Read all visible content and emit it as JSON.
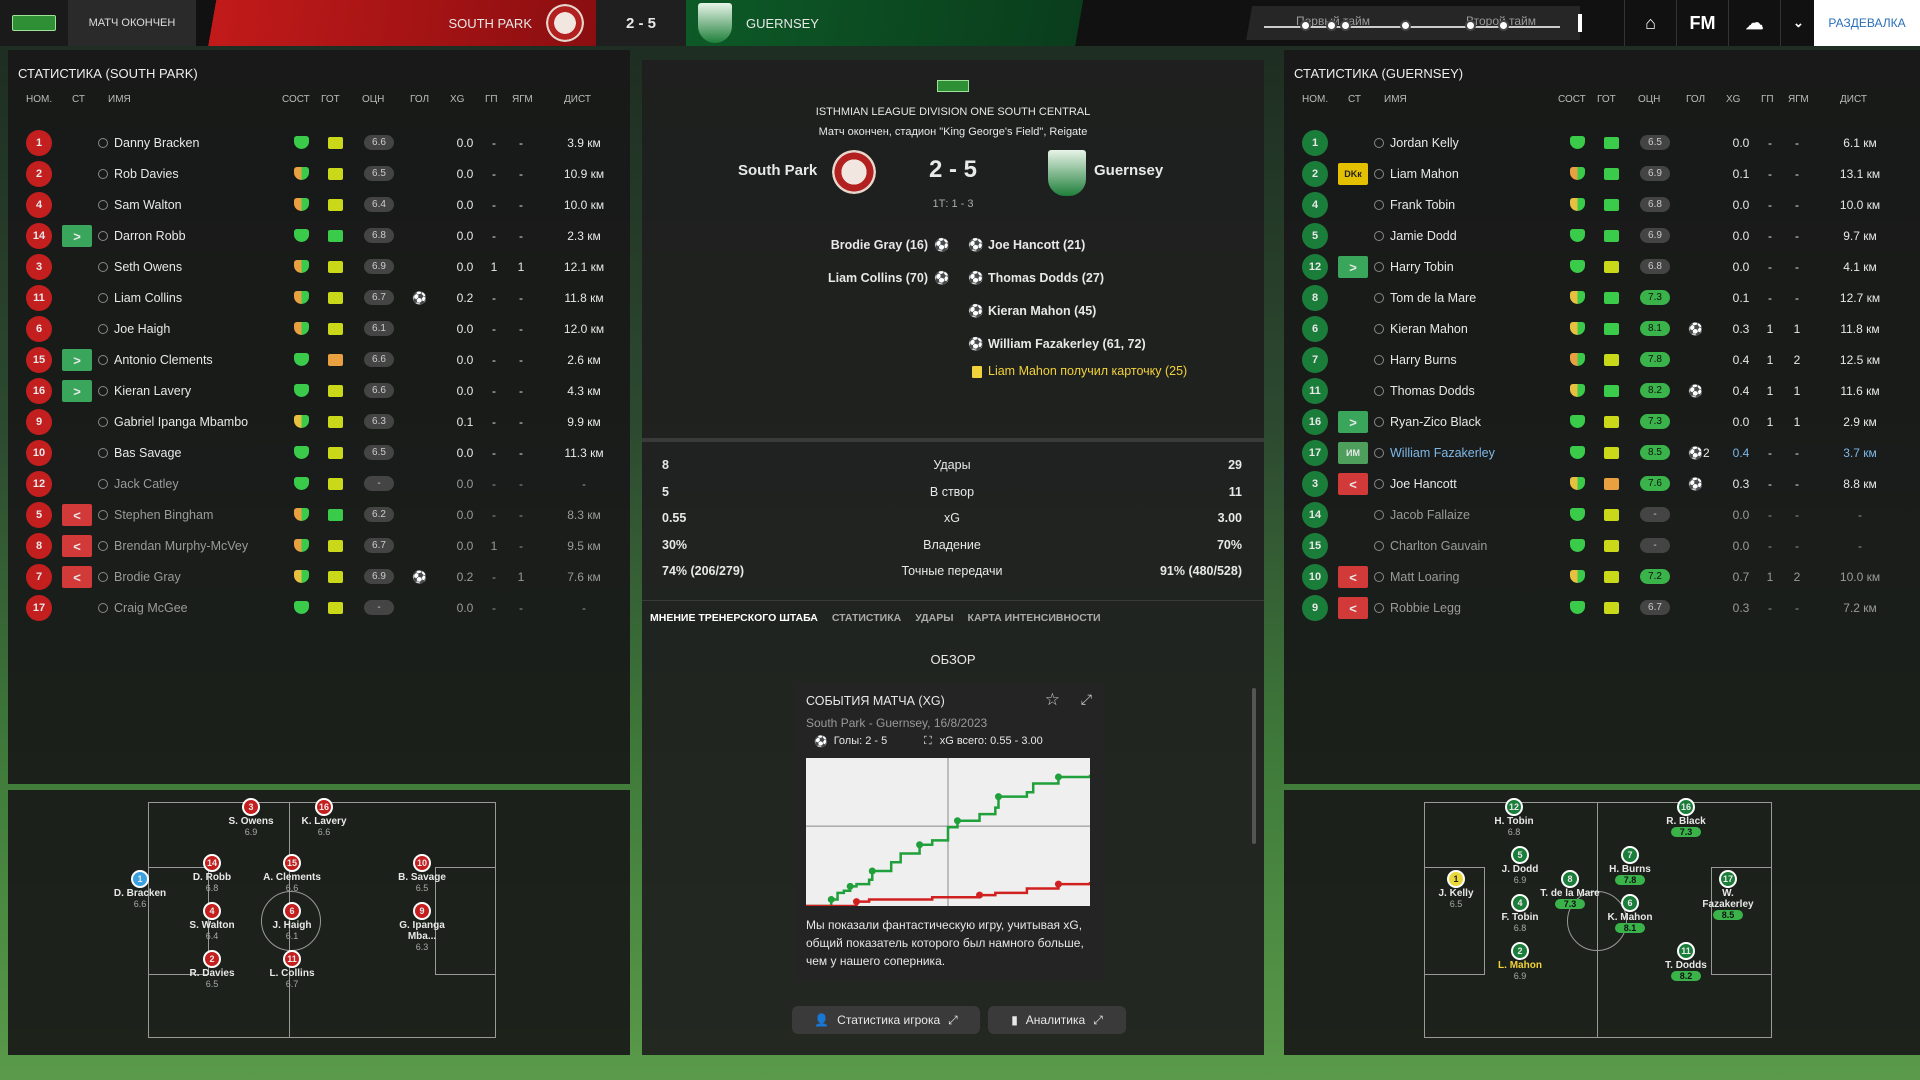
{
  "topbar": {
    "status": "МАТЧ ОКОНЧЕН",
    "home_team": "SOUTH PARK",
    "score": "2 - 5",
    "away_team": "GUERNSEY",
    "first_half": "Первый тайм",
    "second_half": "Второй тайм",
    "fm_label": "FM",
    "continue": "РАЗДЕВАЛКА"
  },
  "home": {
    "title": "СТАТИСТИКА (SOUTH PARK)",
    "headers": {
      "num": "НОМ.",
      "st": "СТ",
      "name": "ИМЯ",
      "cond": "СОСТ",
      "ready": "ГОТ",
      "rating": "ОЦН",
      "goals": "ГОЛ",
      "xg": "XG",
      "gp": "ГП",
      "ygm": "ЯГМ",
      "dist": "ДИСТ"
    },
    "players": [
      {
        "num": "1",
        "name": "Danny Bracken",
        "rating": "6.6",
        "goals": "",
        "xg": "0.0",
        "gp": "-",
        "ygm": "-",
        "dist": "3.9 км",
        "heart": "g",
        "fit": "y",
        "sub": ""
      },
      {
        "num": "2",
        "name": "Rob Davies",
        "rating": "6.5",
        "goals": "",
        "xg": "0.0",
        "gp": "-",
        "ygm": "-",
        "dist": "10.9 км",
        "heart": "o",
        "fit": "y",
        "sub": ""
      },
      {
        "num": "4",
        "name": "Sam Walton",
        "rating": "6.4",
        "goals": "",
        "xg": "0.0",
        "gp": "-",
        "ygm": "-",
        "dist": "10.0 км",
        "heart": "o",
        "fit": "y",
        "sub": ""
      },
      {
        "num": "14",
        "name": "Darron Robb",
        "rating": "6.8",
        "goals": "",
        "xg": "0.0",
        "gp": "-",
        "ygm": "-",
        "dist": "2.3 км",
        "heart": "g",
        "fit": "g",
        "sub": ">"
      },
      {
        "num": "3",
        "name": "Seth Owens",
        "rating": "6.9",
        "goals": "",
        "xg": "0.0",
        "gp": "1",
        "ygm": "1",
        "dist": "12.1 км",
        "heart": "o",
        "fit": "y",
        "sub": ""
      },
      {
        "num": "11",
        "name": "Liam Collins",
        "rating": "6.7",
        "goals": "⚽",
        "xg": "0.2",
        "gp": "-",
        "ygm": "-",
        "dist": "11.8 км",
        "heart": "o",
        "fit": "y",
        "sub": ""
      },
      {
        "num": "6",
        "name": "Joe Haigh",
        "rating": "6.1",
        "goals": "",
        "xg": "0.0",
        "gp": "-",
        "ygm": "-",
        "dist": "12.0 км",
        "heart": "o",
        "fit": "y",
        "sub": ""
      },
      {
        "num": "15",
        "name": "Antonio Clements",
        "rating": "6.6",
        "goals": "",
        "xg": "0.0",
        "gp": "-",
        "ygm": "-",
        "dist": "2.6 км",
        "heart": "g",
        "fit": "o",
        "sub": ">"
      },
      {
        "num": "16",
        "name": "Kieran Lavery",
        "rating": "6.6",
        "goals": "",
        "xg": "0.0",
        "gp": "-",
        "ygm": "-",
        "dist": "4.3 км",
        "heart": "g",
        "fit": "y",
        "sub": ">"
      },
      {
        "num": "9",
        "name": "Gabriel Ipanga Mbambo",
        "rating": "6.3",
        "goals": "",
        "xg": "0.1",
        "gp": "-",
        "ygm": "-",
        "dist": "9.9 км",
        "heart": "y",
        "fit": "y",
        "sub": ""
      },
      {
        "num": "10",
        "name": "Bas Savage",
        "rating": "6.5",
        "goals": "",
        "xg": "0.0",
        "gp": "-",
        "ygm": "-",
        "dist": "11.3 км",
        "heart": "g",
        "fit": "y",
        "sub": ""
      },
      {
        "num": "12",
        "name": "Jack Catley",
        "rating": "-",
        "goals": "",
        "xg": "0.0",
        "gp": "-",
        "ygm": "-",
        "dist": "-",
        "heart": "g",
        "fit": "y",
        "sub": "",
        "dim": true
      },
      {
        "num": "5",
        "name": "Stephen Bingham",
        "rating": "6.2",
        "goals": "",
        "xg": "0.0",
        "gp": "-",
        "ygm": "-",
        "dist": "8.3 км",
        "heart": "o",
        "fit": "g",
        "sub": "<",
        "dim": true
      },
      {
        "num": "8",
        "name": "Brendan Murphy-McVey",
        "rating": "6.7",
        "goals": "",
        "xg": "0.0",
        "gp": "1",
        "ygm": "-",
        "dist": "9.5 км",
        "heart": "o",
        "fit": "y",
        "sub": "<",
        "dim": true
      },
      {
        "num": "7",
        "name": "Brodie Gray",
        "rating": "6.9",
        "goals": "⚽",
        "xg": "0.2",
        "gp": "-",
        "ygm": "1",
        "dist": "7.6 км",
        "heart": "y",
        "fit": "y",
        "sub": "<",
        "dim": true
      },
      {
        "num": "17",
        "name": "Craig McGee",
        "rating": "-",
        "goals": "",
        "xg": "0.0",
        "gp": "-",
        "ygm": "-",
        "dist": "-",
        "heart": "g",
        "fit": "y",
        "sub": "",
        "dim": true
      }
    ],
    "pitch": [
      {
        "num": "3",
        "name": "S. Owens",
        "rt": "6.9"
      },
      {
        "num": "16",
        "name": "K. Lavery",
        "rt": "6.6"
      },
      {
        "num": "1",
        "name": "D. Bracken",
        "rt": "6.6"
      },
      {
        "num": "14",
        "name": "D. Robb",
        "rt": "6.8"
      },
      {
        "num": "15",
        "name": "A. Clements",
        "rt": "6.6"
      },
      {
        "num": "10",
        "name": "B. Savage",
        "rt": "6.5"
      },
      {
        "num": "4",
        "name": "S. Walton",
        "rt": "6.4"
      },
      {
        "num": "6",
        "name": "J. Haigh",
        "rt": "6.1"
      },
      {
        "num": "9",
        "name": "G. Ipanga Mba...",
        "rt": "6.3"
      },
      {
        "num": "2",
        "name": "R. Davies",
        "rt": "6.5"
      },
      {
        "num": "11",
        "name": "L. Collins",
        "rt": "6.7"
      }
    ]
  },
  "away": {
    "title": "СТАТИСТИКА (GUERNSEY)",
    "players": [
      {
        "num": "1",
        "name": "Jordan Kelly",
        "rating": "6.5",
        "goals": "",
        "xg": "0.0",
        "gp": "-",
        "ygm": "-",
        "dist": "6.1 км",
        "heart": "g",
        "fit": "g",
        "sub": ""
      },
      {
        "num": "2",
        "name": "Liam Mahon",
        "rating": "6.9",
        "goals": "",
        "xg": "0.1",
        "gp": "-",
        "ygm": "-",
        "dist": "13.1 км",
        "heart": "o",
        "fit": "g",
        "sub": "DKк"
      },
      {
        "num": "4",
        "name": "Frank Tobin",
        "rating": "6.8",
        "goals": "",
        "xg": "0.0",
        "gp": "-",
        "ygm": "-",
        "dist": "10.0 км",
        "heart": "y",
        "fit": "g",
        "sub": ""
      },
      {
        "num": "5",
        "name": "Jamie Dodd",
        "rating": "6.9",
        "goals": "",
        "xg": "0.0",
        "gp": "-",
        "ygm": "-",
        "dist": "9.7 км",
        "heart": "g",
        "fit": "g",
        "sub": ""
      },
      {
        "num": "12",
        "name": "Harry Tobin",
        "rating": "6.8",
        "goals": "",
        "xg": "0.0",
        "gp": "-",
        "ygm": "-",
        "dist": "4.1 км",
        "heart": "g",
        "fit": "y",
        "sub": ">"
      },
      {
        "num": "8",
        "name": "Tom de la Mare",
        "rating": "7.3",
        "goals": "",
        "xg": "0.1",
        "gp": "-",
        "ygm": "-",
        "dist": "12.7 км",
        "heart": "y",
        "fit": "g",
        "sub": "",
        "hi": true
      },
      {
        "num": "6",
        "name": "Kieran Mahon",
        "rating": "8.1",
        "goals": "⚽",
        "xg": "0.3",
        "gp": "1",
        "ygm": "1",
        "dist": "11.8 км",
        "heart": "y",
        "fit": "g",
        "sub": "",
        "hi": true
      },
      {
        "num": "7",
        "name": "Harry Burns",
        "rating": "7.8",
        "goals": "",
        "xg": "0.4",
        "gp": "1",
        "ygm": "2",
        "dist": "12.5 км",
        "heart": "o",
        "fit": "y",
        "sub": "",
        "hi": true
      },
      {
        "num": "11",
        "name": "Thomas Dodds",
        "rating": "8.2",
        "goals": "⚽",
        "xg": "0.4",
        "gp": "1",
        "ygm": "1",
        "dist": "11.6 км",
        "heart": "y",
        "fit": "g",
        "sub": "",
        "hi": true
      },
      {
        "num": "16",
        "name": "Ryan-Zico Black",
        "rating": "7.3",
        "goals": "",
        "xg": "0.0",
        "gp": "1",
        "ygm": "1",
        "dist": "2.9 км",
        "heart": "g",
        "fit": "y",
        "sub": ">",
        "hi": true
      },
      {
        "num": "17",
        "name": "William Fazakerley",
        "rating": "8.5",
        "goals": "⚽2",
        "xg": "0.4",
        "gp": "-",
        "ygm": "-",
        "dist": "3.7 км",
        "heart": "g",
        "fit": "y",
        "sub": "ИМ",
        "hi": true,
        "highlight": true
      },
      {
        "num": "3",
        "name": "Joe Hancott",
        "rating": "7.6",
        "goals": "⚽",
        "xg": "0.3",
        "gp": "-",
        "ygm": "-",
        "dist": "8.8 км",
        "heart": "y",
        "fit": "o",
        "sub": "<",
        "hi": true
      },
      {
        "num": "14",
        "name": "Jacob Fallaize",
        "rating": "-",
        "goals": "",
        "xg": "0.0",
        "gp": "-",
        "ygm": "-",
        "dist": "-",
        "heart": "g",
        "fit": "y",
        "sub": "",
        "dim": true
      },
      {
        "num": "15",
        "name": "Charlton Gauvain",
        "rating": "-",
        "goals": "",
        "xg": "0.0",
        "gp": "-",
        "ygm": "-",
        "dist": "-",
        "heart": "g",
        "fit": "y",
        "sub": "",
        "dim": true
      },
      {
        "num": "10",
        "name": "Matt Loaring",
        "rating": "7.2",
        "goals": "",
        "xg": "0.7",
        "gp": "1",
        "ygm": "2",
        "dist": "10.0 км",
        "heart": "y",
        "fit": "y",
        "sub": "<",
        "hi": true,
        "dim": true
      },
      {
        "num": "9",
        "name": "Robbie Legg",
        "rating": "6.7",
        "goals": "",
        "xg": "0.3",
        "gp": "-",
        "ygm": "-",
        "dist": "7.2 км",
        "heart": "g",
        "fit": "y",
        "sub": "<",
        "dim": true
      }
    ],
    "pitch": [
      {
        "num": "12",
        "name": "H. Tobin",
        "rt": "6.8"
      },
      {
        "num": "16",
        "name": "R. Black",
        "rt": "7.3",
        "hi": true
      },
      {
        "num": "1",
        "name": "J. Kelly",
        "rt": "6.5"
      },
      {
        "num": "5",
        "name": "J. Dodd",
        "rt": "6.9"
      },
      {
        "num": "8",
        "name": "T. de la Mare",
        "rt": "7.3",
        "hi": true
      },
      {
        "num": "7",
        "name": "H. Burns",
        "rt": "7.8",
        "hi": true
      },
      {
        "num": "17",
        "name": "W. Fazakerley",
        "rt": "8.5",
        "hi": true
      },
      {
        "num": "4",
        "name": "F. Tobin",
        "rt": "6.8"
      },
      {
        "num": "6",
        "name": "K. Mahon",
        "rt": "8.1",
        "hi": true
      },
      {
        "num": "2",
        "name": "L. Mahon",
        "rt": "6.9"
      },
      {
        "num": "11",
        "name": "T. Dodds",
        "rt": "8.2",
        "hi": true
      }
    ]
  },
  "match": {
    "league": "ISTHMIAN LEAGUE DIVISION ONE SOUTH CENTRAL",
    "venue": "Матч окончен, стадион \"King George's Field\", Reigate",
    "home": "South Park",
    "away": "Guernsey",
    "score": "2 - 5",
    "ht": "1Т: 1 - 3",
    "home_goals": [
      "Brodie Gray (16)",
      "Liam Collins (70)"
    ],
    "away_goals": [
      "Joe Hancott (21)",
      "Thomas Dodds (27)",
      "Kieran Mahon (45)",
      "William Fazakerley (61, 72)"
    ],
    "card": "Liam Mahon получил карточку (25)",
    "stats": [
      {
        "h": "8",
        "label": "Удары",
        "a": "29"
      },
      {
        "h": "5",
        "label": "В створ",
        "a": "11"
      },
      {
        "h": "0.55",
        "label": "xG",
        "a": "3.00"
      },
      {
        "h": "30%",
        "label": "Владение",
        "a": "70%"
      },
      {
        "h": "74% (206/279)",
        "label": "Точные передачи",
        "a": "91% (480/528)"
      }
    ],
    "tabs": [
      "МНЕНИЕ ТРЕНЕРСКОГО ШТАБА",
      "СТАТИСТИКА",
      "УДАРЫ",
      "КАРТА ИНТЕНСИВНОСТИ"
    ],
    "overview": "ОБЗОР",
    "card_title": "СОБЫТИЯ МАТЧА (XG)",
    "card_sub": "South Park - Guernsey, 16/8/2023",
    "card_goals": "Голы: 2 - 5",
    "card_xg": "xG всего: 0.55 - 3.00",
    "comment": "Мы показали фантастическую игру, учитывая xG, общий показатель которого был намного больше, чем у нашего соперника.",
    "btn_player": "Статистика игрока",
    "btn_analytics": "Аналитика"
  },
  "chart_data": {
    "type": "line",
    "series": [
      {
        "color": "#1fa03a",
        "x": [
          0,
          8,
          10,
          12,
          14,
          16,
          20,
          21,
          27,
          30,
          36,
          40,
          45,
          48,
          55,
          60,
          61,
          70,
          72,
          80,
          90
        ],
        "y": [
          0,
          0.15,
          0.3,
          0.35,
          0.45,
          0.5,
          0.6,
          0.8,
          1.0,
          1.2,
          1.4,
          1.5,
          1.8,
          1.95,
          2.1,
          2.25,
          2.5,
          2.6,
          2.8,
          2.95,
          3.0
        ]
      },
      {
        "color": "#d02020",
        "x": [
          0,
          16,
          20,
          40,
          55,
          60,
          70,
          80,
          90
        ],
        "y": [
          0,
          0.1,
          0.15,
          0.2,
          0.25,
          0.3,
          0.4,
          0.5,
          0.55
        ]
      }
    ],
    "xlim": [
      0,
      90
    ],
    "ylim": [
      0,
      3.2
    ]
  },
  "colors": {
    "home": "#c41f1f",
    "away": "#1b7d3a",
    "accent": "#39b34a"
  }
}
